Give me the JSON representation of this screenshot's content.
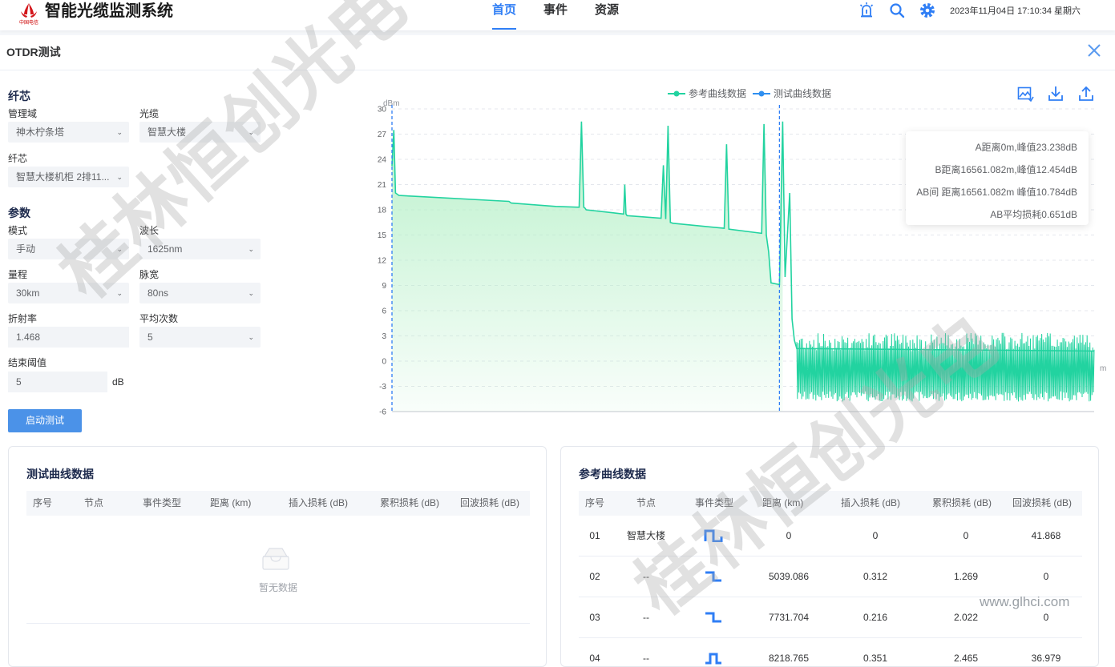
{
  "header": {
    "app_title": "智能光缆监测系统",
    "logo_caption": "中国电信",
    "nav": [
      "首页",
      "事件",
      "资源"
    ],
    "active_nav": 0,
    "datetime": "2023年11月04日 17:10:34 星期六",
    "icons": [
      "alarm-icon",
      "search-icon",
      "gear-icon"
    ]
  },
  "panel": {
    "title": "OTDR测试"
  },
  "fiber": {
    "section_title": "纤芯",
    "domain_label": "管理域",
    "domain_value": "神木柠条塔",
    "cable_label": "光缆",
    "cable_value": "智慧大楼",
    "core_label": "纤芯",
    "core_value": "智慧大楼机柜 2排11..."
  },
  "params": {
    "section_title": "参数",
    "mode_label": "模式",
    "mode_value": "手动",
    "wavelength_label": "波长",
    "wavelength_value": "1625nm",
    "range_label": "量程",
    "range_value": "30km",
    "pulse_label": "脉宽",
    "pulse_value": "80ns",
    "refract_label": "折射率",
    "refract_value": "1.468",
    "avg_label": "平均次数",
    "avg_value": "5",
    "threshold_label": "结束阈值",
    "threshold_value": "5",
    "threshold_unit": "dB",
    "start_button": "启动测试"
  },
  "chart": {
    "legend": [
      "参考曲线数据",
      "测试曲线数据"
    ],
    "colors": {
      "reference": "#22d3a0",
      "test": "#2f8ff0",
      "area": "#b6f0c8",
      "marker": "#2f7ef5"
    },
    "tools": [
      "image-export-icon",
      "download-icon",
      "upload-icon"
    ],
    "y_unit": "dBm",
    "x_unit": "m",
    "marker_a": "A",
    "marker_b": "B",
    "info": [
      "A距离0m,峰值23.238dB",
      "B距离16561.082m,峰值12.454dB",
      "AB间 距离16561.082m 峰值10.784dB",
      "AB平均损耗0.651dB"
    ]
  },
  "chart_data": {
    "type": "line",
    "ylabel": "dBm",
    "xlabel": "m",
    "ylim": [
      -6,
      30
    ],
    "xlim": [
      0,
      30012
    ],
    "y_ticks": [
      "30",
      "27",
      "24",
      "21",
      "18",
      "15",
      "12",
      "9",
      "6",
      "3",
      "0",
      "-3",
      "-6"
    ],
    "x_ticks": [
      "0",
      "3751.490",
      "7502.980",
      "11254.470",
      "15005.960",
      "18757.450",
      "22508.940",
      "26260.430"
    ],
    "grid": true,
    "legend_position": "top-center",
    "markers": {
      "A": 0,
      "B": 16561.082
    },
    "series": [
      {
        "name": "参考曲线数据",
        "x": [
          0,
          80,
          150,
          300,
          1000,
          5000,
          5100,
          7000,
          8000,
          8100,
          8200,
          8250,
          8300,
          9900,
          9950,
          10000,
          10050,
          11500,
          11600,
          11700,
          11800,
          11900,
          12000,
          14200,
          14300,
          14400,
          15800,
          15900,
          16000,
          16100,
          16200,
          16561,
          16700,
          16800,
          17000,
          17100,
          17200,
          17300,
          30012
        ],
        "y": [
          23.2,
          27.5,
          20,
          19.7,
          19.6,
          19.0,
          18.8,
          18.4,
          18.3,
          28.5,
          18.3,
          18.2,
          18.0,
          17.5,
          21.0,
          17.5,
          17.3,
          17.0,
          23.3,
          16.9,
          28.0,
          16.5,
          16.4,
          15.8,
          25.8,
          15.7,
          15.2,
          28.2,
          15.0,
          13.0,
          9.3,
          9.1,
          28.5,
          10.0,
          20.0,
          5.0,
          2.5,
          1.5,
          1.2
        ]
      },
      {
        "name": "测试曲线数据",
        "x": [],
        "y": []
      }
    ]
  },
  "test_table": {
    "title": "测试曲线数据",
    "columns": [
      "序号",
      "节点",
      "事件类型",
      "距离 (km)",
      "插入损耗 (dB)",
      "累积损耗 (dB)",
      "回波损耗 (dB)"
    ],
    "empty_text": "暂无数据",
    "rows": []
  },
  "ref_table": {
    "title": "参考曲线数据",
    "columns": [
      "序号",
      "节点",
      "事件类型",
      "距离 (km)",
      "插入损耗 (dB)",
      "累积损耗 (dB)",
      "回波损耗 (dB)"
    ],
    "rows": [
      {
        "idx": "01",
        "node": "智慧大楼",
        "event": "reflect-start-icon",
        "dist": "0",
        "insert": "0",
        "cum": "0",
        "ret": "41.868"
      },
      {
        "idx": "02",
        "node": "--",
        "event": "step-down-icon",
        "dist": "5039.086",
        "insert": "0.312",
        "cum": "1.269",
        "ret": "0"
      },
      {
        "idx": "03",
        "node": "--",
        "event": "step-down-icon",
        "dist": "7731.704",
        "insert": "0.216",
        "cum": "2.022",
        "ret": "0"
      },
      {
        "idx": "04",
        "node": "--",
        "event": "reflect-event-icon",
        "dist": "8218.765",
        "insert": "0.351",
        "cum": "2.465",
        "ret": "36.979"
      }
    ]
  },
  "watermark": {
    "text": "桂林恒创光电",
    "site": "www.glhci.com"
  }
}
